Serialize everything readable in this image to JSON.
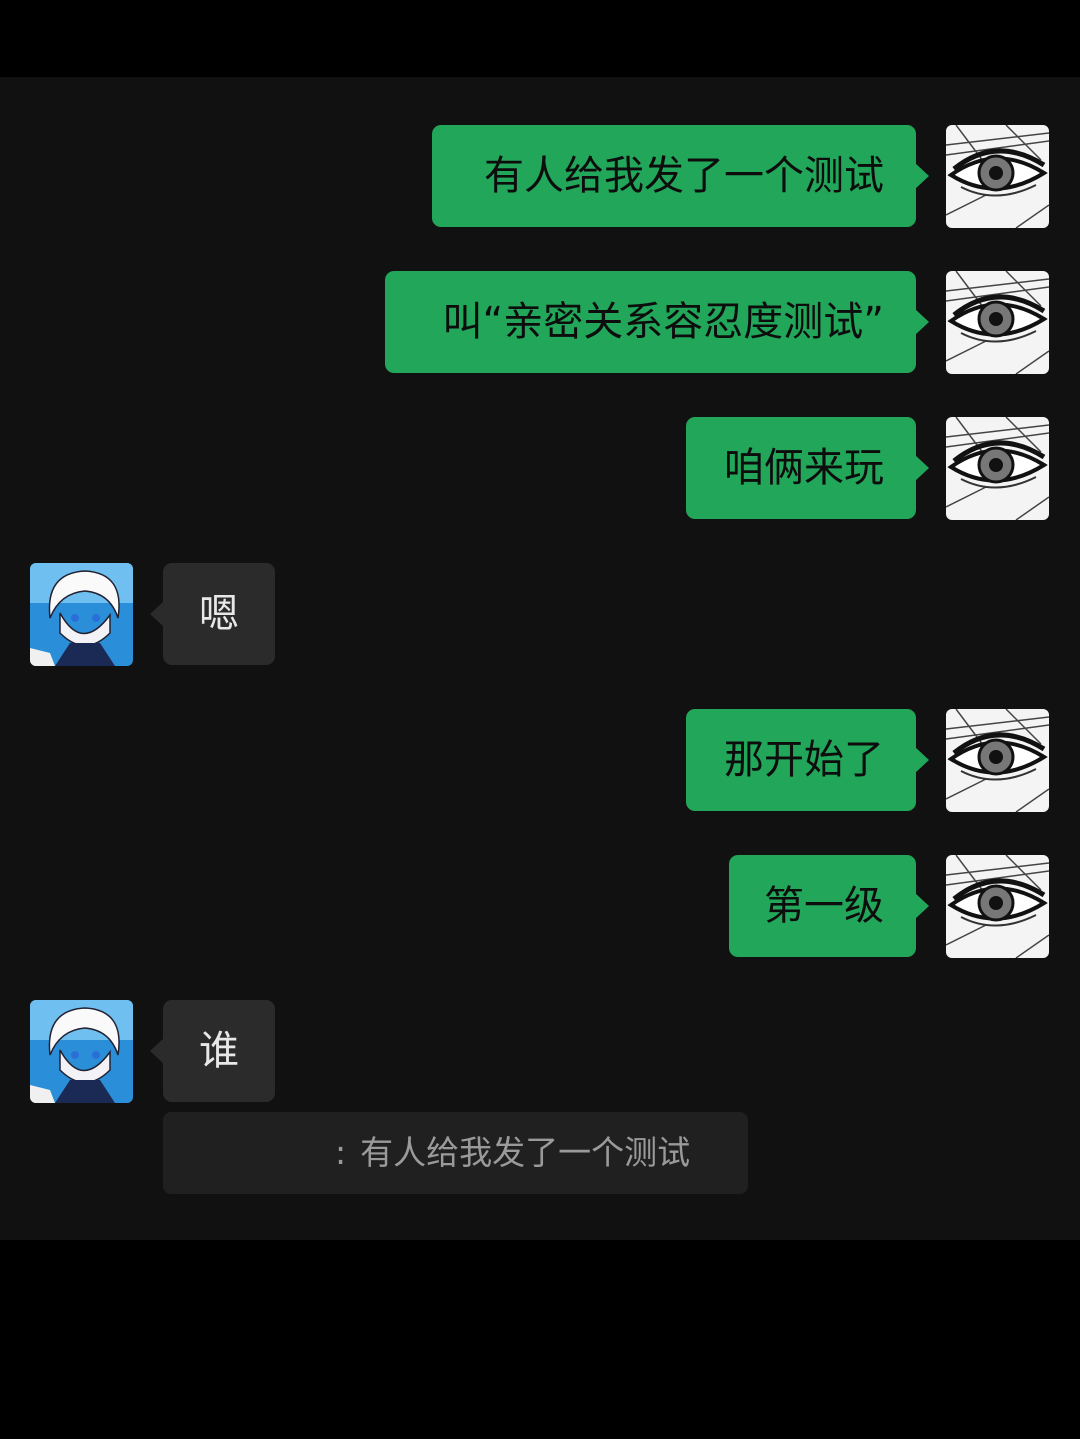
{
  "messages": [
    {
      "side": "me",
      "text": "有人给我发了一个测试"
    },
    {
      "side": "me",
      "text": "叫“亲密关系容忍度测试”"
    },
    {
      "side": "me",
      "text": "咱俩来玩"
    },
    {
      "side": "other",
      "text": "嗯"
    },
    {
      "side": "me",
      "text": "那开始了"
    },
    {
      "side": "me",
      "text": "第一级"
    },
    {
      "side": "other",
      "text": "谁"
    }
  ],
  "quote": {
    "separator": ":",
    "text": "有人给我发了一个测试"
  },
  "avatars": {
    "me": "sketched-eye-avatar",
    "other": "anime-boy-avatar"
  },
  "colors": {
    "my_bubble": "#21a65a",
    "other_bubble": "#2b2b2b",
    "background": "#111111"
  }
}
